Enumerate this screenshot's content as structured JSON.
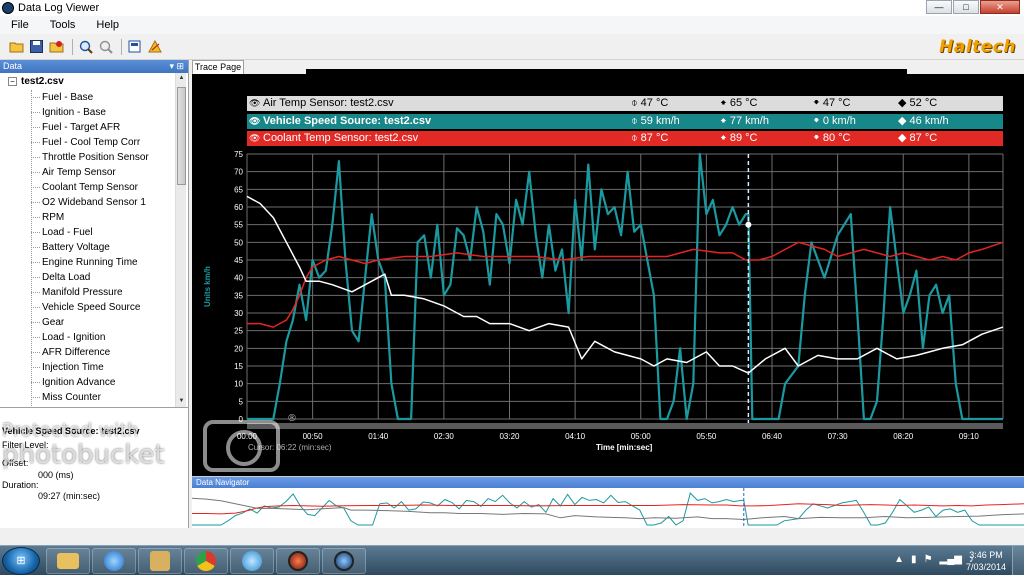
{
  "window": {
    "title": "Data Log Viewer",
    "minimize": "—",
    "maximize": "□",
    "close": "✕"
  },
  "menu": {
    "file": "File",
    "tools": "Tools",
    "help": "Help"
  },
  "toolbar": {
    "logo": "Haltech"
  },
  "left_panel": {
    "header": "Data",
    "root": "test2.csv",
    "items": [
      "Fuel - Base",
      "Ignition - Base",
      "Fuel - Target AFR",
      "Fuel - Cool Temp Corr",
      "Throttle Position Sensor",
      "Air Temp Sensor",
      "Coolant Temp Sensor",
      "O2 Wideband Sensor 1",
      "RPM",
      "Load - Fuel",
      "Battery Voltage",
      "Engine Running Time",
      "Delta Load",
      "Manifold Pressure",
      "Vehicle Speed Source",
      "Gear",
      "Load - Ignition",
      "AFR Difference",
      "Injection Time",
      "Ignition Advance",
      "Miss Counter"
    ]
  },
  "info": {
    "title": "Vehicle Speed Source: test2.csv",
    "filter_label": "Filter Level:",
    "offset_label": "Offset:",
    "offset_value": "000 (ms)",
    "duration_label": "Duration:",
    "duration_value": "09:27 (min:sec)"
  },
  "tab": {
    "label": "Trace Page"
  },
  "legend": [
    {
      "name": "Air Temp Sensor: test2.csv",
      "current": "47 °C",
      "max": "65 °C",
      "min": "47 °C",
      "avg": "52 °C"
    },
    {
      "name": "Vehicle Speed Source: test2.csv",
      "current": "59 km/h",
      "max": "77 km/h",
      "min": "0 km/h",
      "avg": "46 km/h"
    },
    {
      "name": "Coolant Temp Sensor: test2.csv",
      "current": "87 °C",
      "max": "89 °C",
      "min": "80 °C",
      "avg": "87 °C"
    }
  ],
  "legend_symbols": {
    "current": "⌽",
    "max": "🠹",
    "min": "🠻",
    "avg": "◆"
  },
  "chart": {
    "cursor_text": "Cursor: 06:22 (min:sec)",
    "x_title": "Time [min:sec]",
    "y_title": "Units km/h"
  },
  "navigator": {
    "label": "Data Navigator"
  },
  "taskbar": {
    "time": "3:46 PM",
    "date": "7/03/2014"
  },
  "watermark": {
    "line1": "Protected with",
    "line2": "photobucket"
  },
  "colors": {
    "air": "#ffffff",
    "vss": "#1a9aa0",
    "coolant": "#e52420",
    "grid": "#6e6e6e",
    "cursor": "#d8e8ff"
  },
  "chart_data": {
    "type": "line",
    "xlabel": "Time [min:sec]",
    "ylabel": "Units km/h",
    "x_ticks": [
      "00:00",
      "00:50",
      "01:40",
      "02:30",
      "03:20",
      "04:10",
      "05:00",
      "05:50",
      "06:40",
      "07:30",
      "08:20",
      "09:10"
    ],
    "x_tick_seconds": [
      0,
      50,
      100,
      150,
      200,
      250,
      300,
      350,
      400,
      450,
      500,
      550
    ],
    "xlim": [
      0,
      576
    ],
    "ylim": [
      0,
      75
    ],
    "y_ticks": [
      0,
      5,
      10,
      15,
      20,
      25,
      30,
      35,
      40,
      45,
      50,
      55,
      60,
      65,
      70,
      75
    ],
    "cursor_seconds": 382,
    "series": [
      {
        "name": "Air Temp Sensor: test2.csv",
        "color": "#ffffff",
        "t": [
          0,
          10,
          20,
          30,
          40,
          45,
          55,
          65,
          80,
          95,
          105,
          110,
          120,
          135,
          150,
          165,
          175,
          185,
          200,
          215,
          230,
          245,
          255,
          265,
          280,
          290,
          300,
          310,
          320,
          335,
          350,
          360,
          370,
          382,
          395,
          410,
          420,
          435,
          450,
          465,
          480,
          495,
          510,
          520,
          530,
          545,
          560,
          576
        ],
        "values": [
          63,
          61,
          57,
          50,
          43,
          39,
          39,
          38,
          36,
          39,
          41,
          35,
          35,
          34,
          32,
          29,
          29,
          27,
          27,
          25,
          27,
          26,
          17,
          22,
          19,
          18,
          17,
          15,
          17,
          16,
          19,
          15,
          15,
          13,
          17,
          20,
          15,
          18,
          17,
          17,
          20,
          17,
          18,
          19,
          20,
          21,
          24,
          26
        ]
      },
      {
        "name": "Vehicle Speed Source: test2.csv",
        "color": "#1a9aa0",
        "t": [
          0,
          20,
          25,
          30,
          35,
          40,
          45,
          50,
          55,
          60,
          65,
          70,
          75,
          80,
          85,
          90,
          95,
          100,
          105,
          110,
          115,
          125,
          130,
          135,
          140,
          145,
          150,
          155,
          160,
          165,
          170,
          175,
          180,
          185,
          190,
          195,
          200,
          205,
          210,
          215,
          220,
          225,
          230,
          235,
          240,
          245,
          250,
          255,
          260,
          265,
          270,
          275,
          280,
          285,
          290,
          295,
          300,
          305,
          310,
          315,
          320,
          325,
          330,
          335,
          340,
          345,
          350,
          355,
          360,
          365,
          370,
          375,
          380,
          382,
          385,
          390,
          395,
          400,
          405,
          410,
          420,
          425,
          430,
          440,
          450,
          455,
          460,
          465,
          470,
          475,
          480,
          485,
          490,
          495,
          500,
          505,
          510,
          515,
          520,
          525,
          530,
          535,
          540,
          545,
          550,
          555,
          560,
          576
        ],
        "values": [
          0,
          0,
          10,
          22,
          28,
          38,
          28,
          45,
          40,
          42,
          55,
          73,
          45,
          25,
          22,
          40,
          58,
          45,
          40,
          10,
          0,
          0,
          50,
          52,
          40,
          55,
          35,
          38,
          54,
          52,
          45,
          60,
          53,
          38,
          58,
          55,
          44,
          62,
          55,
          70,
          52,
          40,
          55,
          42,
          48,
          30,
          62,
          45,
          72,
          48,
          65,
          58,
          60,
          52,
          70,
          53,
          55,
          45,
          35,
          0,
          0,
          5,
          20,
          0,
          10,
          75,
          58,
          62,
          52,
          55,
          60,
          55,
          58,
          58,
          0,
          0,
          0,
          0,
          0,
          10,
          15,
          35,
          50,
          40,
          52,
          55,
          58,
          30,
          0,
          0,
          5,
          30,
          60,
          45,
          30,
          35,
          42,
          20,
          35,
          38,
          30,
          35,
          10,
          0,
          0,
          0,
          0,
          0
        ]
      },
      {
        "name": "Coolant Temp Sensor: test2.csv",
        "color": "#e52420",
        "t": [
          0,
          10,
          20,
          25,
          30,
          35,
          40,
          45,
          50,
          55,
          60,
          70,
          80,
          90,
          100,
          120,
          140,
          160,
          180,
          200,
          220,
          240,
          260,
          280,
          300,
          320,
          340,
          360,
          370,
          380,
          390,
          400,
          410,
          420,
          430,
          440,
          450,
          460,
          470,
          480,
          490,
          500,
          510,
          520,
          530,
          540,
          550,
          560,
          576
        ],
        "values": [
          27,
          27,
          26,
          27,
          28,
          31,
          35,
          40,
          43,
          44,
          45,
          46,
          45,
          44,
          45,
          46,
          46,
          47,
          46,
          46,
          46,
          45,
          46,
          46,
          46,
          46,
          48,
          47,
          47,
          45,
          45,
          46,
          48,
          50,
          49,
          48,
          46,
          47,
          48,
          47,
          46,
          47,
          46,
          45,
          46,
          45,
          47,
          48,
          50
        ]
      }
    ]
  }
}
